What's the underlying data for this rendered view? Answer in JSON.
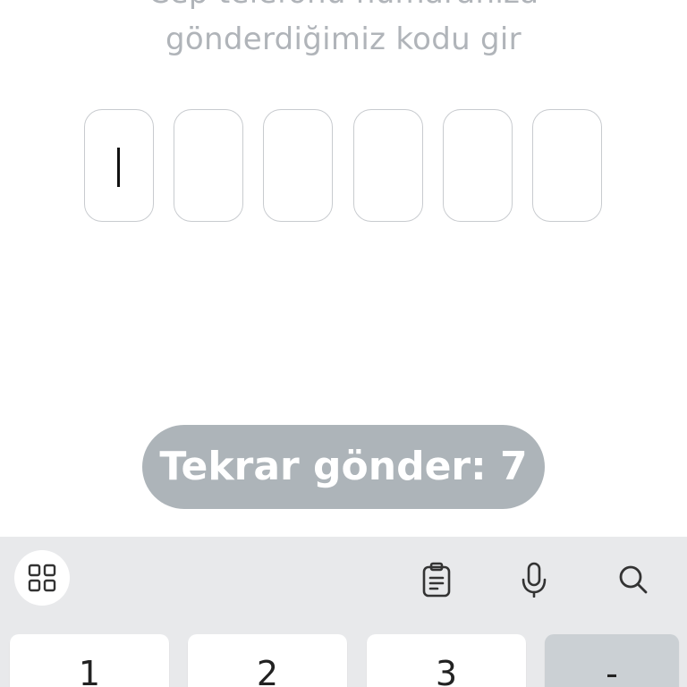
{
  "instruction": {
    "line_partial": "Cep telefonu numaranıza",
    "line_main": "gönderdiğimiz kodu gir"
  },
  "code_input": {
    "length": 6,
    "active_index": 0
  },
  "resend": {
    "label": "Tekrar gönder: 7"
  },
  "keyboard": {
    "toolbar_icons": [
      "apps-grid-icon",
      "clipboard-icon",
      "microphone-icon",
      "search-icon"
    ],
    "keys": [
      "1",
      "2",
      "3",
      "-"
    ]
  },
  "colors": {
    "text_muted": "#b0b4b9",
    "button_bg": "#adb4b9",
    "keyboard_bg": "#e8e9eb",
    "box_border": "#c8cbcf"
  }
}
